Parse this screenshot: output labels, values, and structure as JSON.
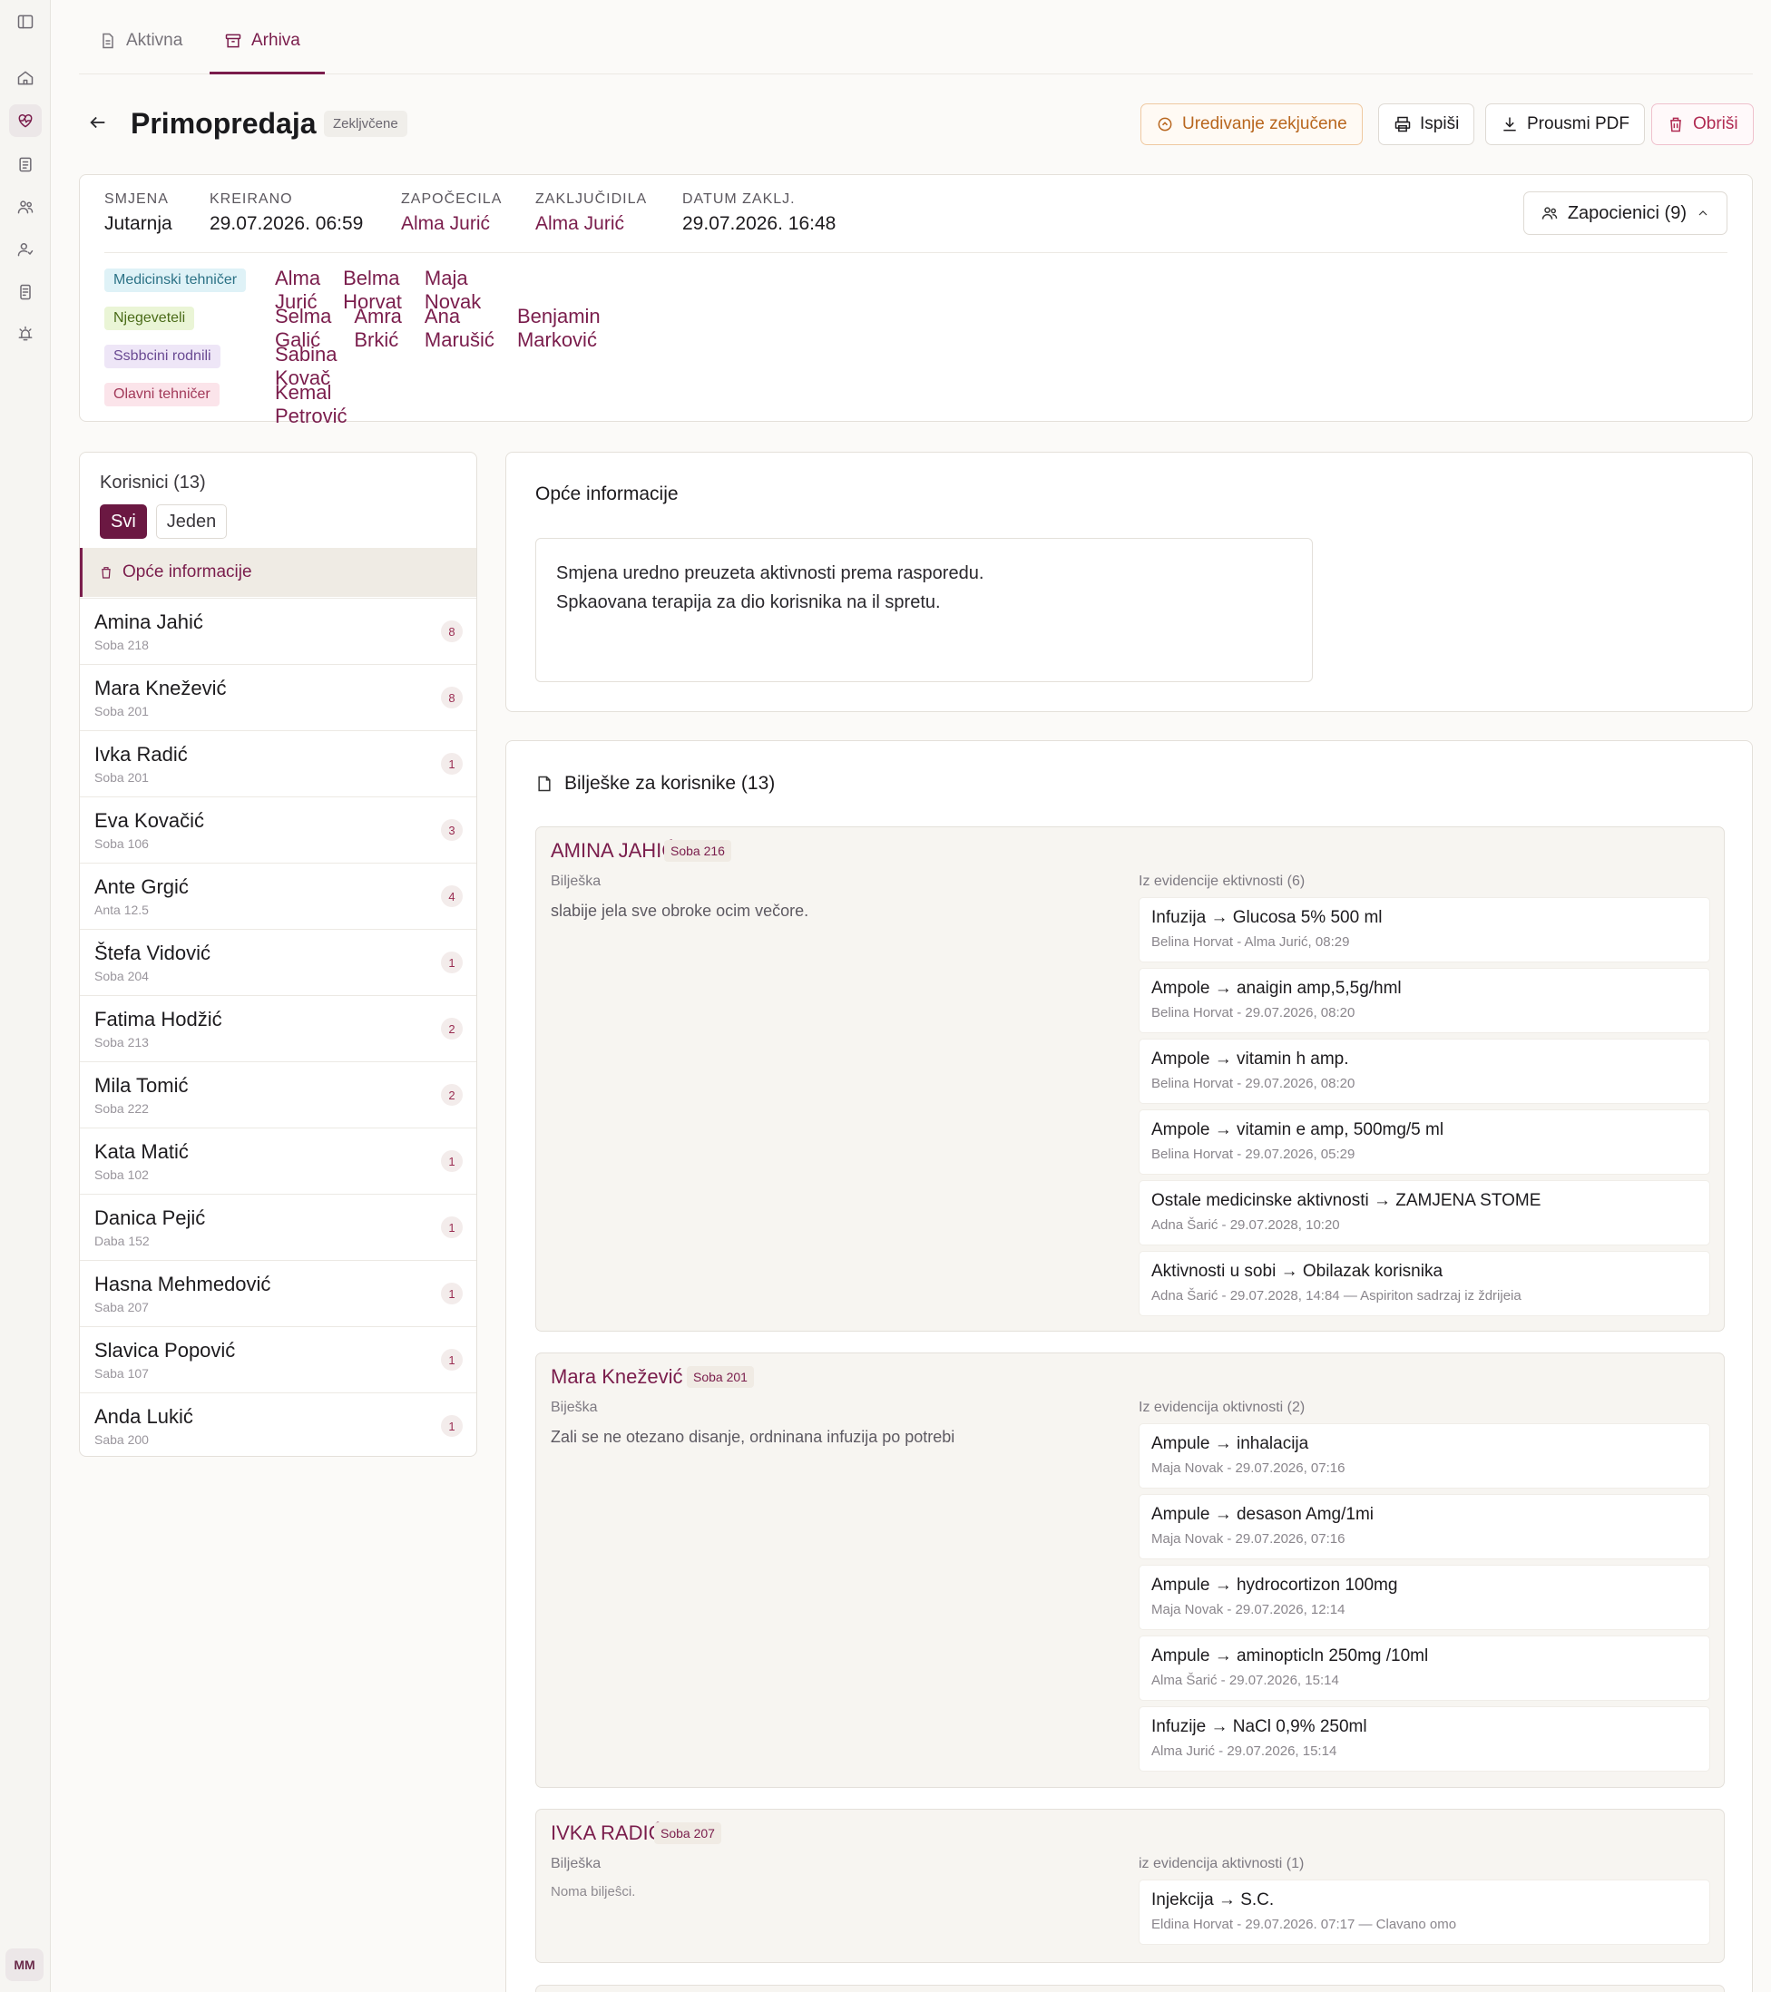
{
  "rail": {
    "avatar": "MM"
  },
  "tabs": [
    {
      "label": "Aktivna"
    },
    {
      "label": "Arhiva"
    }
  ],
  "header": {
    "title": "Primopredaja",
    "status": "Zekljvčene",
    "buttons": {
      "edit": "Uredivanje zekjučene",
      "print": "Ispiši",
      "pdf": "Prousmi PDF",
      "delete": "Obriši"
    }
  },
  "summary": {
    "meta": [
      {
        "label": "Smjena",
        "value": "Jutarnja"
      },
      {
        "label": "Kreirano",
        "value": "29.07.2026. 06:59"
      },
      {
        "label": "Započecila",
        "value": "Alma Jurić"
      },
      {
        "label": "Zaključidila",
        "value": "Alma Jurić"
      },
      {
        "label": "Datum zaklj.",
        "value": "29.07.2026. 16:48"
      }
    ],
    "team_button": "Zapocienici (9)",
    "roles": [
      {
        "role": "Medicinski tehničer",
        "names": [
          "Alma Jurić",
          "Belma Horvat",
          "Maja Novak"
        ]
      },
      {
        "role": "Njegeveteli",
        "names": [
          "Selma Galić",
          "Amra Brkić",
          "Ana Marušić",
          "Benjamin Marković"
        ]
      },
      {
        "role": "Ssbbcini rodnili",
        "names": [
          "Sabina Kovač"
        ]
      },
      {
        "role": "Olavni tehničer",
        "names": [
          "Kemal Petrović"
        ]
      }
    ]
  },
  "users": {
    "title": "Korisnici (13)",
    "filter": {
      "all": "Svi",
      "one": "Jeden"
    },
    "general_item": "Opće informacije",
    "list": [
      {
        "name": "Amina Jahić",
        "room": "Soba 218",
        "count": "8"
      },
      {
        "name": "Mara Knežević",
        "room": "Soba 201",
        "count": "8"
      },
      {
        "name": "Ivka Radić",
        "room": "Soba 201",
        "count": "1"
      },
      {
        "name": "Eva Kovačić",
        "room": "Soba 106",
        "count": "3"
      },
      {
        "name": "Ante Grgić",
        "room": "Anta 12.5",
        "count": "4"
      },
      {
        "name": "Štefa Vidović",
        "room": "Soba 204",
        "count": "1"
      },
      {
        "name": "Fatima Hodžić",
        "room": "Soba 213",
        "count": "2"
      },
      {
        "name": "Mila Tomić",
        "room": "Soba 222",
        "count": "2"
      },
      {
        "name": "Kata Matić",
        "room": "Soba 102",
        "count": "1"
      },
      {
        "name": "Danica Pejić",
        "room": "Daba 152",
        "count": "1"
      },
      {
        "name": "Hasna Mehmedović",
        "room": "Saba 207",
        "count": "1"
      },
      {
        "name": "Slavica Popović",
        "room": "Saba 107",
        "count": "1"
      },
      {
        "name": "Anda Lukić",
        "room": "Saba 200",
        "count": "1"
      }
    ]
  },
  "general": {
    "title": "Opće informacije",
    "lines": [
      "Smjena uredno preuzeta aktivnosti prema rasporedu.",
      "Spkaovana terapija za dio korisnika na il spretu."
    ]
  },
  "notes": {
    "title": "Bilješke za korisnike (13)",
    "patients": [
      {
        "name": "AMINA JAHIĆ",
        "room": "Soba 216",
        "note_label": "Bilješka",
        "note": "slabije jela sve obroke ocim večore.",
        "acts_label": "Iz evidencije ektivnosti (6)",
        "acts": [
          {
            "t": "Infuzija → Glucosa 5% 500 ml",
            "s": "Belina Horvat - Alma Jurić, 08:29"
          },
          {
            "t": "Ampole → anaigin amp,5,5g/hml",
            "s": "Belina Horvat - 29.07.2026, 08:20"
          },
          {
            "t": "Ampole → vitamin h amp.",
            "s": "Belina Horvat - 29.07.2026, 08:20"
          },
          {
            "t": "Ampole → vitamin e amp, 500mg/5 ml",
            "s": "Belina Horvat - 29.07.2026, 05:29"
          },
          {
            "t": "Ostale medicinske aktivnosti → ZAMJENA STOME",
            "s": "Adna Šarić - 29.07.2028, 10:20"
          },
          {
            "t": "Aktivnosti u sobi → Obilazak korisnika",
            "s": "Adna Šarić - 29.07.2028, 14:84 — Aspiriton sadrzaj iz ždrijeia"
          }
        ]
      },
      {
        "name": "Mara Knežević",
        "room": "Soba 201",
        "note_label": "Biješka",
        "note": "Zali se ne otezano disanje, ordninana infuzija po potrebi",
        "acts_label": "Iz evidencija oktivnosti (2)",
        "acts": [
          {
            "t": "Ampule → inhalacija",
            "s": "Maja Novak - 29.07.2026, 07:16"
          },
          {
            "t": "Ampule → desason Amg/1mi",
            "s": "Maja Novak - 29.07.2026, 07:16"
          },
          {
            "t": "Ampule → hydrocortizon 100mg",
            "s": "Maja Novak - 29.07.2026, 12:14"
          },
          {
            "t": "Ampule → aminopticln 250mg /10ml",
            "s": "Alma Šarić - 29.07.2026, 15:14"
          },
          {
            "t": "Infuzije → NaCl 0,9% 250ml",
            "s": "Alma Jurić - 29.07.2026, 15:14"
          }
        ]
      },
      {
        "name": "IVKA RADIĆ",
        "room": "Soba 207",
        "note_label": "Bilješka",
        "note": "Noma biljeŝci.",
        "acts_label": "iz evidencija aktivnosti (1)",
        "acts": [
          {
            "t": "Injekcija → S.C.",
            "s": "Eldina Horvat - 29.07.2026. 07:17 — Clavano omo"
          }
        ]
      }
    ]
  }
}
